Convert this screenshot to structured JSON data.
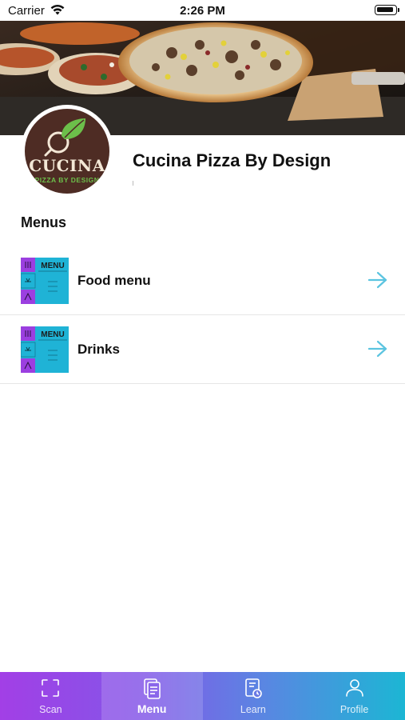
{
  "status_bar": {
    "carrier": "Carrier",
    "time": "2:26 PM"
  },
  "restaurant": {
    "name": "Cucina Pizza By Design",
    "logo_main": "CUCINA",
    "logo_sub": "PIZZA BY DESIGN"
  },
  "menus": {
    "title": "Menus",
    "thumb_label": "MENU",
    "items": [
      {
        "label": "Food menu"
      },
      {
        "label": "Drinks"
      }
    ]
  },
  "tabs": [
    {
      "label": "Scan",
      "icon": "scan-icon"
    },
    {
      "label": "Menu",
      "icon": "menu-icon",
      "active": true
    },
    {
      "label": "Learn",
      "icon": "learn-icon"
    },
    {
      "label": "Profile",
      "icon": "profile-icon"
    }
  ],
  "colors": {
    "accent_arrow": "#5bc4e0",
    "tab_gradient_start": "#a23fe6",
    "tab_gradient_end": "#1cb6d4",
    "logo_background": "#4e2c24"
  }
}
